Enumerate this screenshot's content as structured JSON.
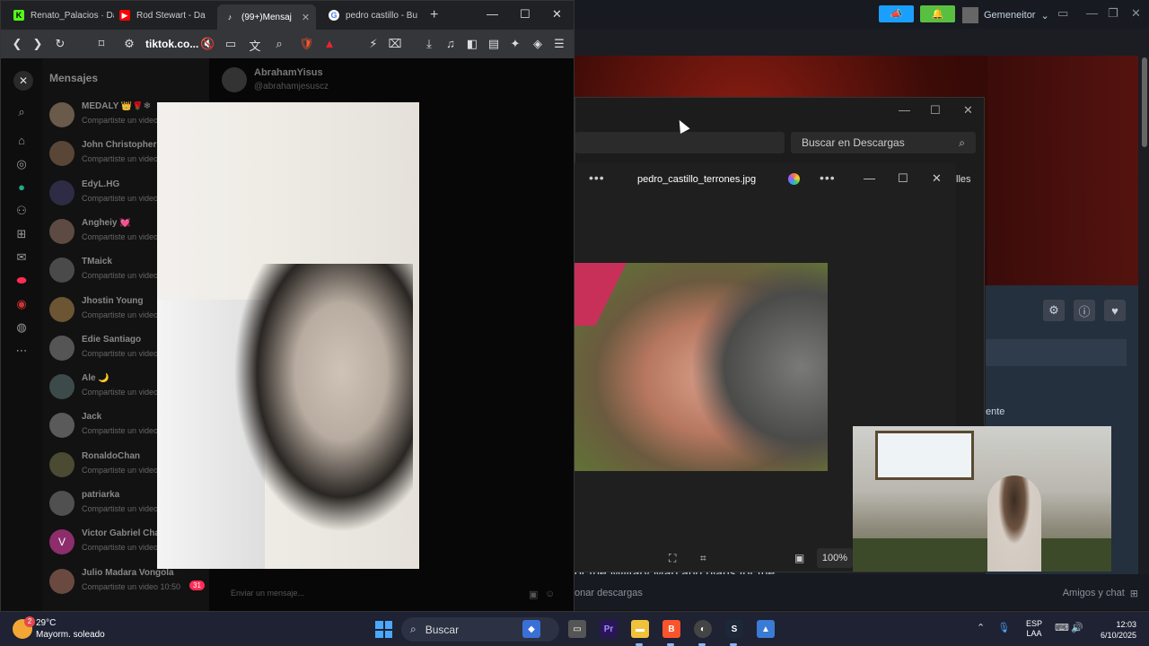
{
  "browser": {
    "tabs": [
      {
        "label": "Renato_Palacios · Da",
        "icon": "kick-icon",
        "color": "#53fc18"
      },
      {
        "label": "Rod Stewart - Da",
        "icon": "youtube-icon",
        "color": "#ff0000"
      },
      {
        "label": "(99+)Mensaj",
        "icon": "tiktok-icon",
        "color": "#000000"
      },
      {
        "label": "pedro castillo - Bu",
        "icon": "google-icon",
        "color": "#4285f4"
      }
    ],
    "url": "tiktok.co..."
  },
  "tiktok": {
    "messages_title": "Mensajes",
    "conversations": [
      {
        "name": "MEDALY 👑🌹❄",
        "preview": "Compartiste un video"
      },
      {
        "name": "John Christopher",
        "preview": "Compartiste un video"
      },
      {
        "name": "EdyL.HG",
        "preview": "Compartiste un video"
      },
      {
        "name": "Angheiy 💓",
        "preview": "Compartiste un video"
      },
      {
        "name": "TMaick",
        "preview": "Compartiste un video"
      },
      {
        "name": "Jhostin Young",
        "preview": "Compartiste un video"
      },
      {
        "name": "Edie Santiago",
        "preview": "Compartiste un video"
      },
      {
        "name": "Ale 🌙",
        "preview": "Compartiste un video"
      },
      {
        "name": "Jack",
        "preview": "Compartiste un video"
      },
      {
        "name": "RonaldoChan",
        "preview": "Compartiste un video"
      },
      {
        "name": "patriarka",
        "preview": "Compartiste un video"
      },
      {
        "name": "Victor Gabriel Cha",
        "preview": "Compartiste un video",
        "avatar_letter": "V"
      },
      {
        "name": "Julio Madara Vongola",
        "preview": "Compartiste un video 10:50",
        "badge": "31"
      }
    ],
    "chat_name": "AbrahamYisus",
    "chat_handle": "@abrahamjesuscz",
    "input_placeholder": "Enviar un mensaje..."
  },
  "explorer": {
    "search_placeholder": "Buscar en Descargas",
    "details_label": "lles"
  },
  "viewer": {
    "filename": "pedro_castillo_terrones.jpg",
    "zoom": "100%"
  },
  "background_app": {
    "user_name": "Gemeneitor",
    "friends_label": "Amigos y chat",
    "downloads_label": "onar descargas",
    "side_label": "ente",
    "map_text": "or the Military Map and plans for the"
  },
  "taskbar": {
    "temperature": "29°C",
    "weather": "Mayorm. soleado",
    "weather_badge": "2",
    "search_label": "Buscar",
    "lang_top": "ESP",
    "lang_bottom": "LAA",
    "time": "12:03",
    "date": "6/10/2025"
  }
}
